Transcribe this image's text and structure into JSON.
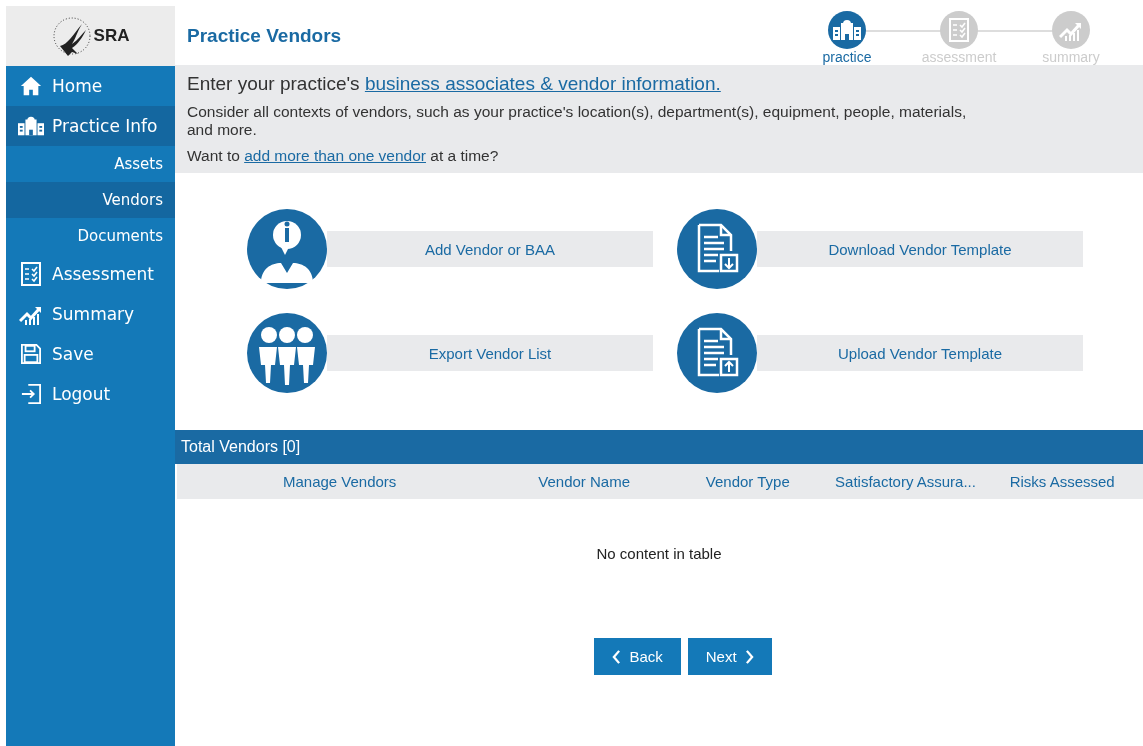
{
  "logo": {
    "text": "SRA"
  },
  "sidebar": {
    "items": [
      {
        "label": "Home",
        "selected": false
      },
      {
        "label": "Practice Info",
        "selected": true,
        "children": [
          {
            "label": "Assets",
            "selected": false
          },
          {
            "label": "Vendors",
            "selected": true
          },
          {
            "label": "Documents",
            "selected": false
          }
        ]
      },
      {
        "label": "Assessment",
        "selected": false
      },
      {
        "label": "Summary",
        "selected": false
      },
      {
        "label": "Save",
        "selected": false
      },
      {
        "label": "Logout",
        "selected": false
      }
    ]
  },
  "page_title": "Practice Vendors",
  "steps": [
    {
      "label": "practice",
      "selected": true
    },
    {
      "label": "assessment",
      "selected": false
    },
    {
      "label": "summary",
      "selected": false
    }
  ],
  "intro": {
    "line1": {
      "text": "Enter your practice's",
      "link": "business associates & vendor information."
    },
    "line2": [
      "Consider all contexts of vendors, such as your practice's location(s), department(s), equipment, people, materials,",
      "and more."
    ],
    "line3": {
      "text": "Want to",
      "link": "add more than one vendor",
      "after": "at a time?"
    }
  },
  "actions": [
    {
      "label": "Add Vendor or BAA"
    },
    {
      "label": "Download Vendor Template"
    },
    {
      "label": "Export Vendor List"
    },
    {
      "label": "Upload Vendor Template"
    }
  ],
  "table": {
    "title": "Total Vendors [0]",
    "columns": [
      "Manage Vendors",
      "Vendor Name",
      "Vendor Type",
      "Satisfactory Assura...",
      "Risks Assessed"
    ],
    "empty_message": "No content in table"
  },
  "buttons": [
    {
      "label": "Back",
      "kind": "back"
    },
    {
      "label": "Next",
      "kind": "next"
    }
  ]
}
